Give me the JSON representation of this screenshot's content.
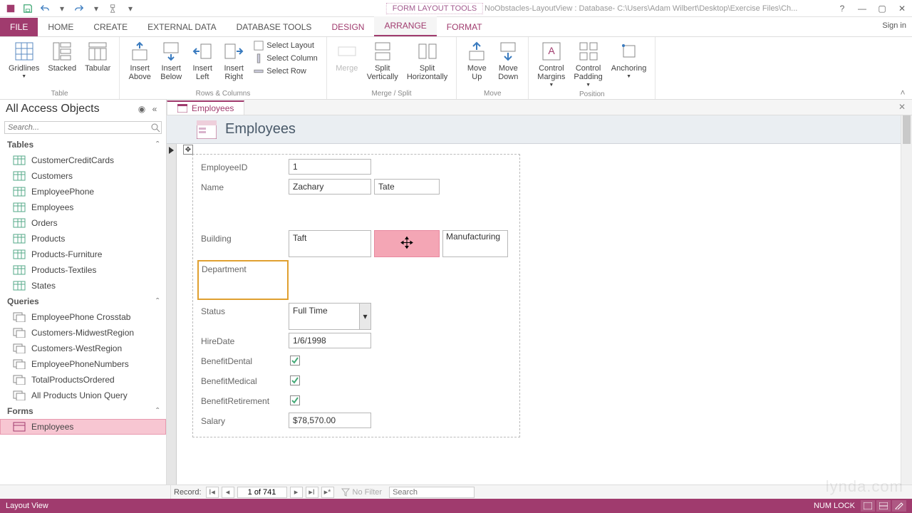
{
  "window": {
    "form_tools": "FORM LAYOUT TOOLS",
    "title": "NoObstacles-LayoutView : Database- C:\\Users\\Adam Wilbert\\Desktop\\Exercise Files\\Ch...",
    "signin": "Sign in"
  },
  "tabs": {
    "file": "FILE",
    "home": "HOME",
    "create": "CREATE",
    "external": "EXTERNAL DATA",
    "dbtools": "DATABASE TOOLS",
    "design": "DESIGN",
    "arrange": "ARRANGE",
    "format": "FORMAT"
  },
  "ribbon": {
    "gridlines": "Gridlines",
    "stacked": "Stacked",
    "tabular": "Tabular",
    "table_group": "Table",
    "insert_above": "Insert\nAbove",
    "insert_below": "Insert\nBelow",
    "insert_left": "Insert\nLeft",
    "insert_right": "Insert\nRight",
    "select_layout": "Select Layout",
    "select_column": "Select Column",
    "select_row": "Select Row",
    "rows_cols_group": "Rows & Columns",
    "merge": "Merge",
    "split_v": "Split\nVertically",
    "split_h": "Split\nHorizontally",
    "merge_split_group": "Merge / Split",
    "move_up": "Move\nUp",
    "move_down": "Move\nDown",
    "move_group": "Move",
    "control_margins": "Control\nMargins",
    "control_padding": "Control\nPadding",
    "anchoring": "Anchoring",
    "position_group": "Position"
  },
  "navpane": {
    "title": "All Access Objects",
    "search_placeholder": "Search...",
    "tables_hdr": "Tables",
    "tables": [
      "CustomerCreditCards",
      "Customers",
      "EmployeePhone",
      "Employees",
      "Orders",
      "Products",
      "Products-Furniture",
      "Products-Textiles",
      "States"
    ],
    "queries_hdr": "Queries",
    "queries": [
      "EmployeePhone Crosstab",
      "Customers-MidwestRegion",
      "Customers-WestRegion",
      "EmployeePhoneNumbers",
      "TotalProductsOrdered",
      "All Products Union Query"
    ],
    "forms_hdr": "Forms",
    "forms": [
      "Employees"
    ]
  },
  "doc": {
    "tab": "Employees",
    "header_title": "Employees"
  },
  "form": {
    "labels": {
      "employee_id": "EmployeeID",
      "name": "Name",
      "building": "Building",
      "department": "Department",
      "status": "Status",
      "hire_date": "HireDate",
      "benefit_dental": "BenefitDental",
      "benefit_medical": "BenefitMedical",
      "benefit_retirement": "BenefitRetirement",
      "salary": "Salary"
    },
    "values": {
      "employee_id": "1",
      "first_name": "Zachary",
      "last_name": "Tate",
      "building": "Taft",
      "department": "Manufacturing",
      "status": "Full Time",
      "hire_date": "1/6/1998",
      "salary": "$78,570.00"
    }
  },
  "recordnav": {
    "label": "Record:",
    "position": "1 of 741",
    "no_filter": "No Filter",
    "search_placeholder": "Search"
  },
  "status": {
    "view": "Layout View",
    "numlock": "NUM LOCK"
  },
  "watermark": "lynda.com"
}
